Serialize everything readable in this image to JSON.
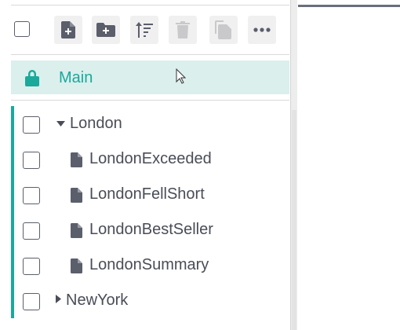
{
  "toolbar": {
    "buttons": [
      {
        "name": "select-all-checkbox"
      },
      {
        "name": "new-file-button",
        "icon": "file-plus-icon"
      },
      {
        "name": "new-folder-button",
        "icon": "folder-plus-icon"
      },
      {
        "name": "sort-button",
        "icon": "sort-icon"
      },
      {
        "name": "delete-button",
        "icon": "trash-icon"
      },
      {
        "name": "copy-button",
        "icon": "copy-icon"
      },
      {
        "name": "more-button",
        "icon": "more-horizontal-icon"
      }
    ]
  },
  "root": {
    "label": "Main",
    "icon": "lock-icon",
    "accent_color": "#1aa99b",
    "highlight_color": "#dbefed"
  },
  "tree": {
    "folder": {
      "label": "London",
      "expanded": true
    },
    "items": [
      {
        "label": "LondonExceeded"
      },
      {
        "label": "LondonFellShort"
      },
      {
        "label": "LondonBestSeller"
      },
      {
        "label": "LondonSummary"
      }
    ],
    "collapsed_folder": {
      "label": "NewYork",
      "expanded": false
    }
  }
}
